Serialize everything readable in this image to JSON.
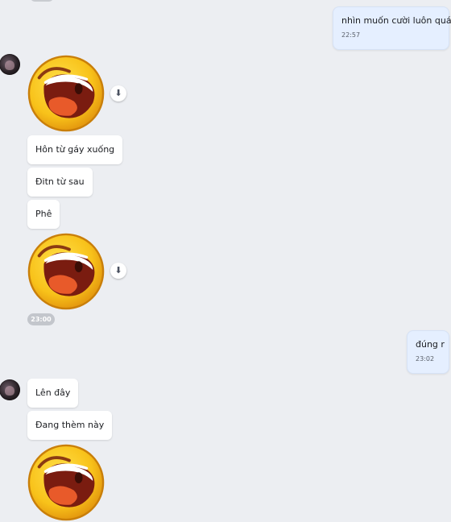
{
  "messages": {
    "out_1": {
      "text": "nhìn muốn cười luôn quá",
      "time": "22:57"
    },
    "in_1": "Hôn từ gáy xuống",
    "in_2": "Đitn từ sau",
    "in_3": "Phê",
    "time_chip": "23:00",
    "out_2": {
      "text": "đúng r",
      "time": "23:02"
    },
    "in_4": "Lên đây",
    "in_5": "Đang thèm này"
  },
  "icons": {
    "sticker": "laughing-emoji-sticker",
    "download": "download-icon",
    "avatar": "contact-avatar"
  },
  "colors": {
    "background": "#eceef2",
    "outgoing_bubble": "#e5efff",
    "incoming_bubble": "#ffffff",
    "time_chip": "#c3c6cc"
  }
}
